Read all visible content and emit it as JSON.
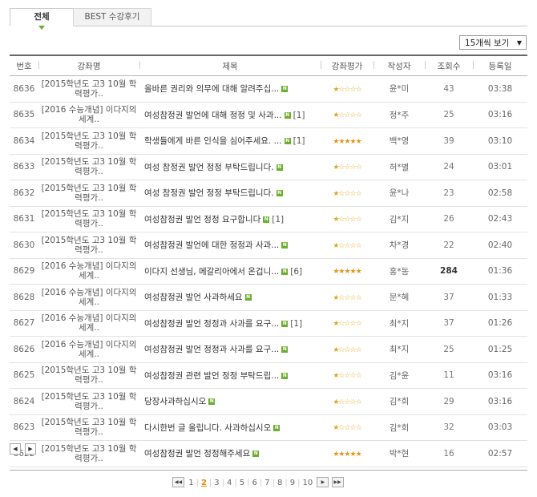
{
  "tabs": {
    "all": "전체",
    "best": "BEST 수강후기"
  },
  "page_size": {
    "selected": "15개씩 보기"
  },
  "table": {
    "headers": {
      "no": "번호",
      "course": "강좌명",
      "title": "제목",
      "rating": "강좌평가",
      "author": "작성자",
      "views": "조회수",
      "date": "등록일"
    },
    "rows": [
      {
        "no": "8636",
        "course": "[2015학년도 고3 10월 학력평가..",
        "title": "올바른 권리와 의무에 대해 알려주십...",
        "comments": "",
        "stars": "★☆☆☆☆",
        "author": "윤*미",
        "views": "43",
        "date": "03:38"
      },
      {
        "no": "8635",
        "course": "[2016 수능개념] 이다지의 세계..",
        "title": "여성참정권 발언에 대해 정정 및 사과...",
        "comments": "[1]",
        "stars": "★☆☆☆☆",
        "author": "정*주",
        "views": "25",
        "date": "03:16"
      },
      {
        "no": "8634",
        "course": "[2015학년도 고3 10월 학력평가..",
        "title": "학생들에게 바른 인식을 심어주세요. ...",
        "comments": "[1]",
        "stars": "★★★★★",
        "author": "백*영",
        "views": "39",
        "date": "03:10"
      },
      {
        "no": "8633",
        "course": "[2015학년도 고3 10월 학력평가..",
        "title": "여성 참정권 발언 정정 부탁드립니다.",
        "comments": "",
        "stars": "★☆☆☆☆",
        "author": "허*별",
        "views": "24",
        "date": "03:01"
      },
      {
        "no": "8632",
        "course": "[2015학년도 고3 10월 학력평가..",
        "title": "여성 참정권 발언 정정 부탁드립니다.",
        "comments": "",
        "stars": "★☆☆☆☆",
        "author": "윤*나",
        "views": "23",
        "date": "02:58"
      },
      {
        "no": "8631",
        "course": "[2015학년도 고3 10월 학력평가..",
        "title": "여성참정권 발언 정정 요구합니다",
        "comments": "[1]",
        "stars": "★☆☆☆☆",
        "author": "김*지",
        "views": "26",
        "date": "02:43"
      },
      {
        "no": "8630",
        "course": "[2015학년도 고3 10월 학력평가..",
        "title": "여성참정권 발언에 대한 정정과 사과...",
        "comments": "",
        "stars": "★☆☆☆☆",
        "author": "차*경",
        "views": "22",
        "date": "02:40"
      },
      {
        "no": "8629",
        "course": "[2016 수능개념] 이다지의 세계..",
        "title": "이다지 선생님, 메갈리아에서 온겁니...",
        "comments": "[6]",
        "stars": "★★★★★",
        "author": "홍*동",
        "views": "284",
        "date": "01:36"
      },
      {
        "no": "8628",
        "course": "[2016 수능개념] 이다지의 세계..",
        "title": "여성참정권 발언 사과하세요",
        "comments": "",
        "stars": "★☆☆☆☆",
        "author": "문*혜",
        "views": "37",
        "date": "01:33"
      },
      {
        "no": "8627",
        "course": "[2016 수능개념] 이다지의 세계..",
        "title": "여성참정권 발언 정정과 사과를 요구...",
        "comments": "[1]",
        "stars": "★☆☆☆☆",
        "author": "최*지",
        "views": "37",
        "date": "01:26"
      },
      {
        "no": "8626",
        "course": "[2016 수능개념] 이다지의 세계..",
        "title": "여성참정권 발언 정정과 사과를 요구...",
        "comments": "",
        "stars": "★☆☆☆☆",
        "author": "최*지",
        "views": "25",
        "date": "01:25"
      },
      {
        "no": "8625",
        "course": "[2015학년도 고3 10월 학력평가..",
        "title": "여성참정권 관련 발언 정정 부탁드립...",
        "comments": "",
        "stars": "★☆☆☆☆",
        "author": "김*윤",
        "views": "11",
        "date": "03:16"
      },
      {
        "no": "8624",
        "course": "[2015학년도 고3 10월 학력평가..",
        "title": "당장사과하십시오",
        "comments": "",
        "stars": "★☆☆☆☆",
        "author": "김*희",
        "views": "29",
        "date": "03:16"
      },
      {
        "no": "8623",
        "course": "[2015학년도 고3 10월 학력평가..",
        "title": "다시한번 글 올립니다. 사과하십시오",
        "comments": "",
        "stars": "★☆☆☆☆",
        "author": "김*희",
        "views": "32",
        "date": "03:03"
      },
      {
        "no": "8622",
        "course": "[2015학년도 고3 10월 학력평가..",
        "title": "여성참정권 발언 정정해주세요",
        "comments": "",
        "stars": "★★★★★",
        "author": "박*현",
        "views": "16",
        "date": "02:57"
      }
    ],
    "new_badge": "N"
  },
  "scroll": {
    "left": "◀",
    "right": "▶"
  },
  "pagination": {
    "first": "◀◀",
    "next": "▶",
    "last": "▶▶",
    "pages": [
      "1",
      "2",
      "3",
      "4",
      "5",
      "6",
      "7",
      "8",
      "9",
      "10"
    ],
    "current": "2"
  },
  "colors": {
    "accent_green": "#6cae2d",
    "star": "#e8931a",
    "current_page": "#e48a00"
  }
}
